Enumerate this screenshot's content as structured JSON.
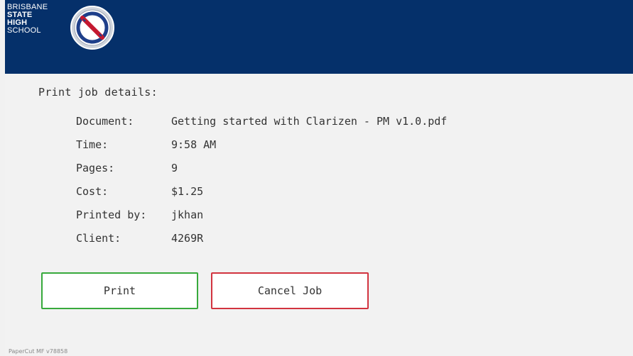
{
  "header": {
    "logo_lines": [
      "BRISBANE",
      "STATE",
      "HIGH",
      "SCHOOL"
    ],
    "crest_icon": "school-crest-icon",
    "brand_color": "#05306a"
  },
  "job": {
    "section_title": "Print job details:",
    "rows": [
      {
        "label": "Document:",
        "value": "Getting started with Clarizen - PM v1.0.pdf"
      },
      {
        "label": "Time:",
        "value": "9:58 AM"
      },
      {
        "label": "Pages:",
        "value": "9"
      },
      {
        "label": "Cost:",
        "value": "$1.25"
      },
      {
        "label": "Printed by:",
        "value": "jkhan"
      },
      {
        "label": "Client:",
        "value": "4269R"
      }
    ]
  },
  "actions": {
    "print_label": "Print",
    "cancel_label": "Cancel Job",
    "print_color": "#37a93c",
    "cancel_color": "#d2333f"
  },
  "footer": {
    "version": "PaperCut MF v78858"
  }
}
